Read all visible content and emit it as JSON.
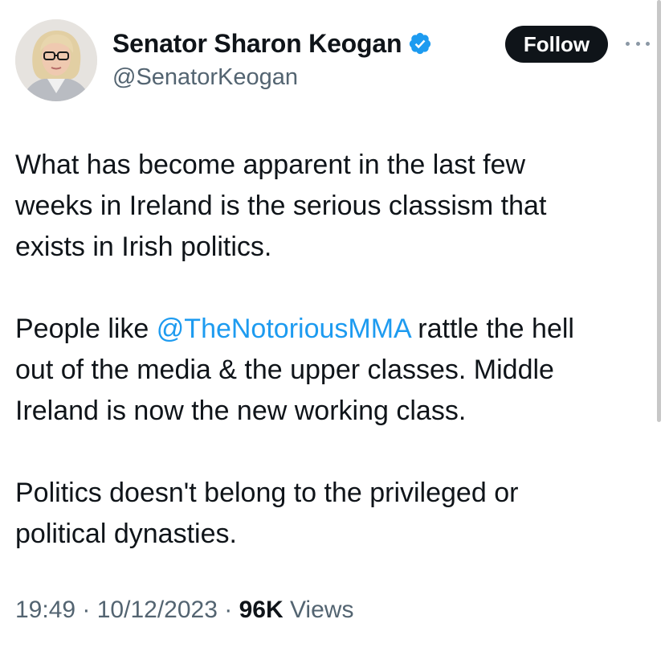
{
  "author": {
    "display_name": "Senator Sharon Keogan",
    "handle": "@SenatorKeogan"
  },
  "follow_label": "Follow",
  "tweet": {
    "para1": [
      "What has become apparent in the last few",
      "weeks in Ireland is the serious classism that",
      "exists in Irish politics."
    ],
    "para2": {
      "line1_prefix": "People like ",
      "mention": "@TheNotoriousMMA",
      "line1_suffix": " rattle the hell",
      "line2": "out of the media & the upper classes.  Middle",
      "line3": "Ireland is now the new working class."
    },
    "para3": [
      "Politics doesn't belong to the privileged or",
      "political dynasties."
    ]
  },
  "meta": {
    "time": "19:49",
    "sep1": " · ",
    "date": "10/12/2023",
    "sep2": " · ",
    "views_count": "96K",
    "views_label": " Views"
  },
  "colors": {
    "link": "#1d9bf0",
    "verified": "#1d9bf0",
    "follow_bg": "#0f1419",
    "secondary_text": "#536471"
  },
  "icons": {
    "verified": "verified-badge-icon",
    "more": "more-options-icon"
  }
}
